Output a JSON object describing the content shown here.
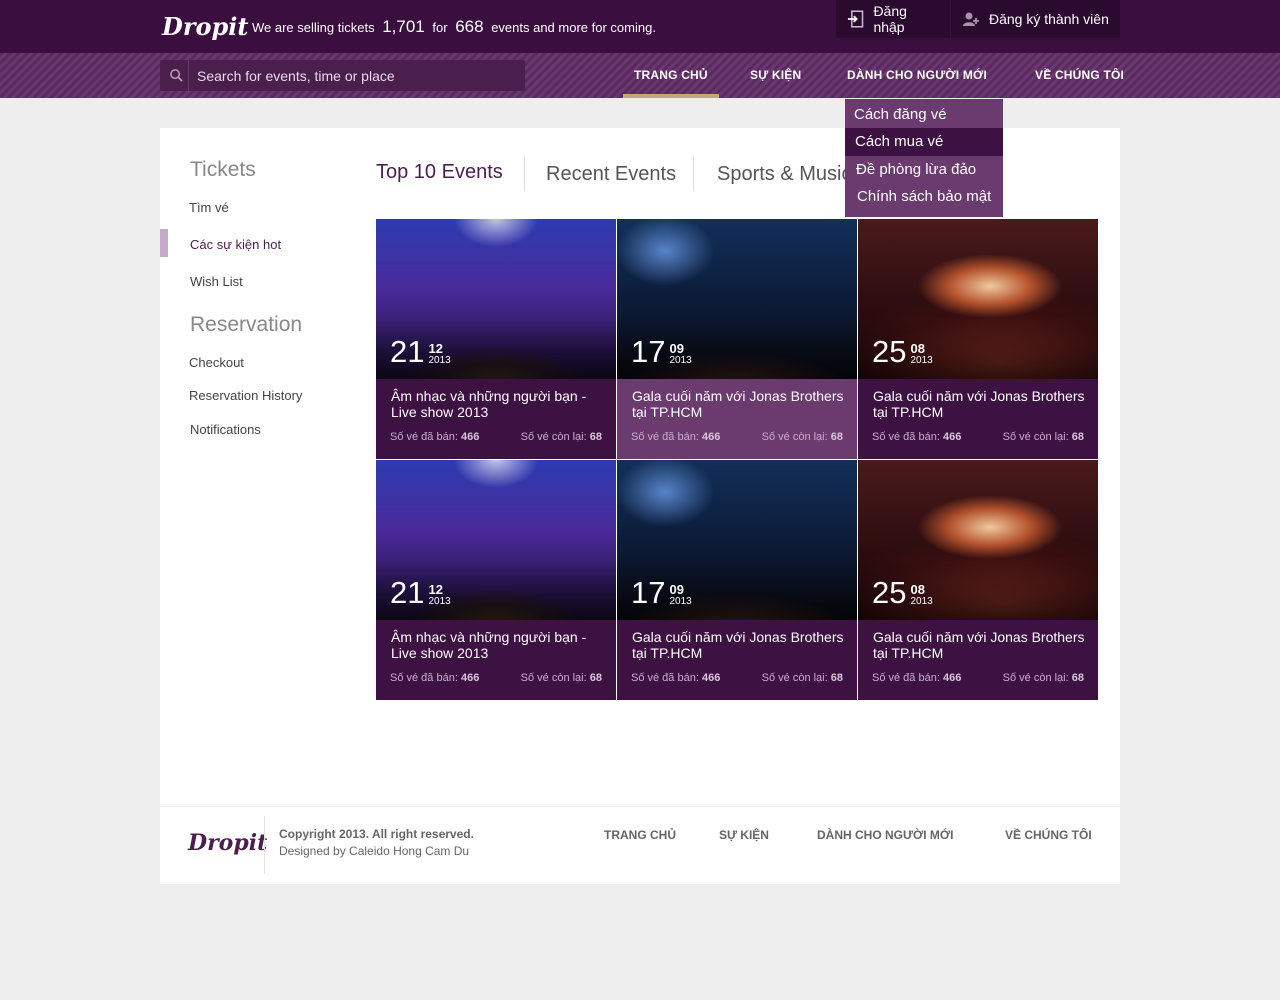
{
  "brand": {
    "logo": "Dropit"
  },
  "topbar": {
    "tagline_pre": "We are selling tickets",
    "tickets_count": "1,701",
    "tagline_mid": "for",
    "events_count": "668",
    "tagline_post": "events and more for coming.",
    "login_label": "Đăng nhập",
    "register_label": "Đăng ký thành viên"
  },
  "search": {
    "placeholder": "Search for events, time or place"
  },
  "nav": {
    "items": [
      {
        "label": "TRANG CHỦ",
        "active": true
      },
      {
        "label": "SỰ KIỆN",
        "active": false
      },
      {
        "label": "DÀNH CHO NGƯỜI MỚI",
        "active": false
      },
      {
        "label": "VỀ CHÚNG TÔI",
        "active": false
      }
    ],
    "dropdown": [
      {
        "label": "Cách đăng vé"
      },
      {
        "label": "Cách mua vé",
        "hover": true
      },
      {
        "label": "Đề phòng lừa đảo"
      },
      {
        "label": "Chính sách bảo mật"
      }
    ]
  },
  "sidebar": {
    "tickets_heading": "Tickets",
    "tickets_links": [
      {
        "label": "Tìm vé"
      },
      {
        "label": "Các sự kiện hot",
        "active": true
      },
      {
        "label": "Wish List"
      }
    ],
    "reservation_heading": "Reservation",
    "reservation_links": [
      {
        "label": "Checkout"
      },
      {
        "label": "Reservation History"
      },
      {
        "label": "Notifications"
      }
    ]
  },
  "tabs": [
    {
      "label": "Top 10 Events",
      "active": true
    },
    {
      "label": "Recent Events"
    },
    {
      "label": "Sports & Music"
    }
  ],
  "stats_labels": {
    "sold": "Số vé đã bán:",
    "left": "Số vé còn lại:"
  },
  "events": [
    {
      "day": "21",
      "month": "12",
      "year": "2013",
      "title": "Âm nhạc và những người bạn - Live show 2013",
      "sold": "466",
      "left": "68",
      "image": "concert-stage",
      "highlight": false
    },
    {
      "day": "17",
      "month": "09",
      "year": "2013",
      "title": "Gala cuối năm với Jonas Brothers tại TP.HCM",
      "sold": "466",
      "left": "68",
      "image": "concert-crowd",
      "highlight": true
    },
    {
      "day": "25",
      "month": "08",
      "year": "2013",
      "title": "Gala cuối năm với Jonas Brothers tại TP.HCM",
      "sold": "466",
      "left": "68",
      "image": "concert-hall",
      "highlight": false
    },
    {
      "day": "21",
      "month": "12",
      "year": "2013",
      "title": "Âm nhạc và những người bạn - Live show 2013",
      "sold": "466",
      "left": "68",
      "image": "concert-stage",
      "highlight": false
    },
    {
      "day": "17",
      "month": "09",
      "year": "2013",
      "title": "Gala cuối năm với Jonas Brothers tại TP.HCM",
      "sold": "466",
      "left": "68",
      "image": "concert-crowd",
      "highlight": false
    },
    {
      "day": "25",
      "month": "08",
      "year": "2013",
      "title": "Gala cuối năm với Jonas Brothers tại TP.HCM",
      "sold": "466",
      "left": "68",
      "image": "concert-hall",
      "highlight": false
    }
  ],
  "footer": {
    "copyright": "Copyright 2013. All right reserved.",
    "designer": "Designed by Caleido Hong Cam Du",
    "links": [
      {
        "label": "TRANG CHỦ"
      },
      {
        "label": "SỰ KIỆN"
      },
      {
        "label": "DÀNH CHO NGƯỜI MỚI"
      },
      {
        "label": "VỀ CHÚNG TÔI"
      }
    ]
  },
  "colors": {
    "topbar": "#3a0f3f",
    "accent_purple": "#3d1142",
    "highlight_purple": "#6b3a6f",
    "active_underline": "#c9a57a"
  },
  "icons": {
    "login": "login-door-icon",
    "register": "add-user-icon",
    "search": "search-icon"
  }
}
